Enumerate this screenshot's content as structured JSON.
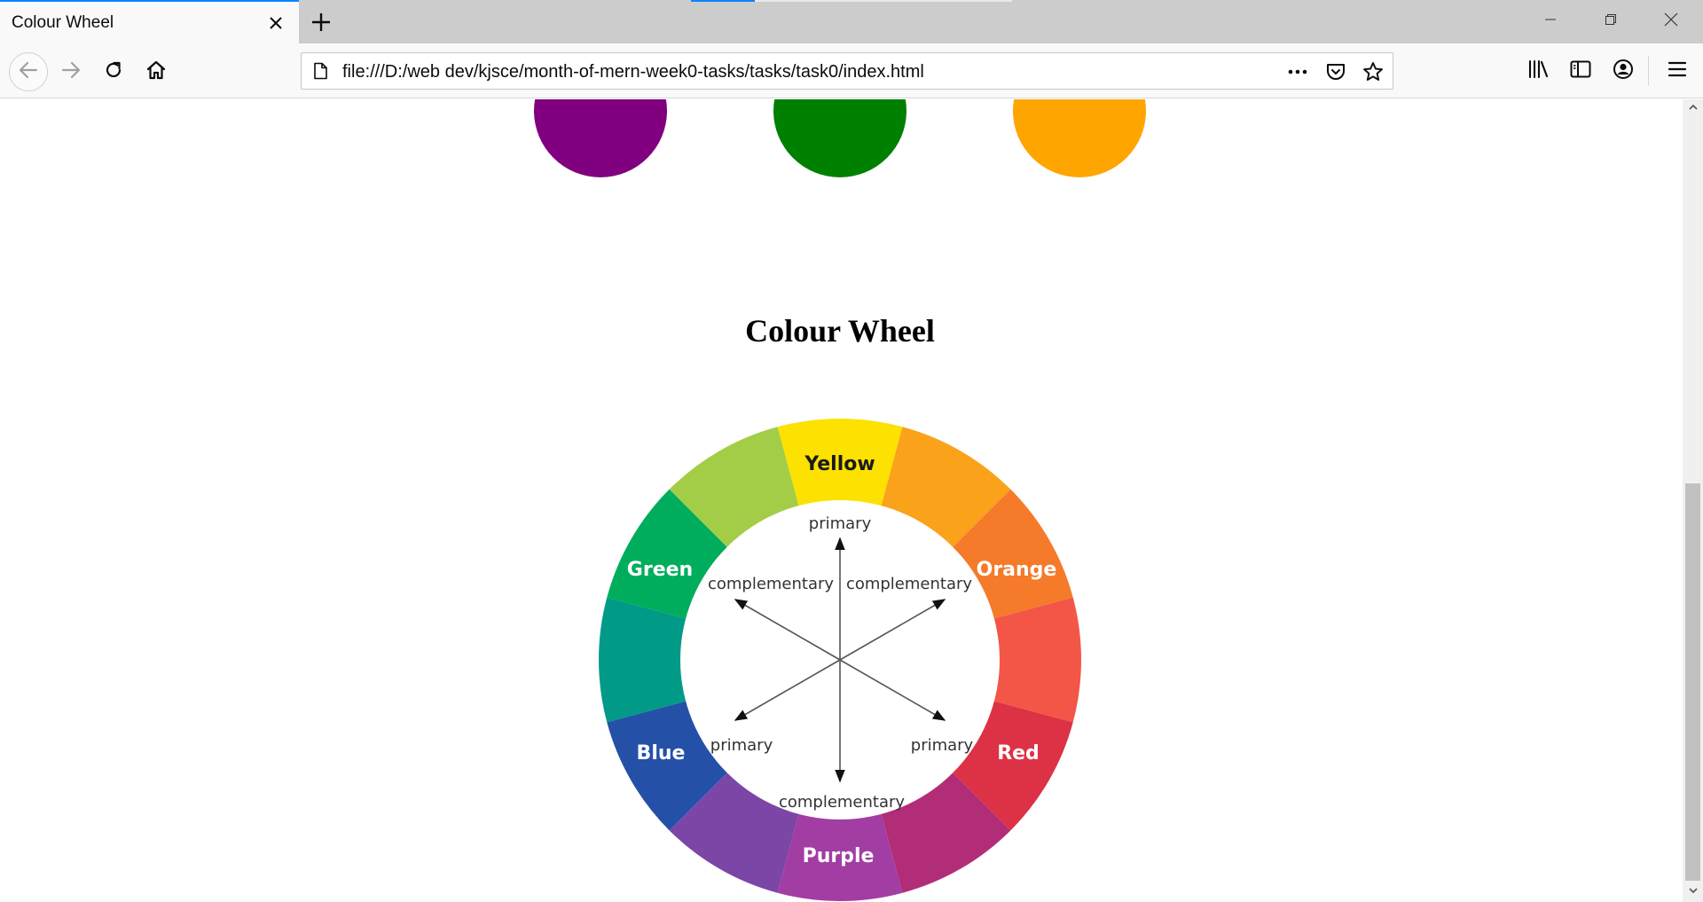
{
  "browser": {
    "tab": {
      "title": "Colour Wheel"
    },
    "url": "file:///D:/web dev/kjsce/month-of-mern-week0-tasks/tasks/task0/index.html",
    "icons": {
      "close_tab": "close-icon",
      "new_tab": "plus-icon",
      "back": "back-arrow-icon",
      "forward": "forward-arrow-icon",
      "reload": "reload-icon",
      "home": "home-icon",
      "page": "page-icon",
      "more": "more-dots-icon",
      "pocket": "pocket-icon",
      "bookmark": "star-icon",
      "library": "library-icon",
      "sidebar": "sidebar-icon",
      "account": "account-icon",
      "menu": "hamburger-menu-icon"
    }
  },
  "page": {
    "circles": [
      {
        "name": "purple",
        "color": "#800080"
      },
      {
        "name": "green",
        "color": "#008000"
      },
      {
        "name": "orange",
        "color": "#ffa500"
      }
    ],
    "heading": "Colour Wheel",
    "wheel": {
      "labels": {
        "yellow": "Yellow",
        "orange": "Orange",
        "red": "Red",
        "purple": "Purple",
        "blue": "Blue",
        "green": "Green"
      },
      "inner_labels": {
        "primary_top": "primary",
        "primary_left": "primary",
        "primary_right": "primary",
        "comp_left": "complementary",
        "comp_right": "complementary",
        "comp_bottom": "complementary"
      },
      "segment_colors": [
        "#fde101",
        "#faa21a",
        "#f57a2a",
        "#f35646",
        "#dd3145",
        "#b22d77",
        "#a23da3",
        "#7b46a6",
        "#2550a8",
        "#009a87",
        "#00ad5c",
        "#a3cd47"
      ]
    }
  }
}
